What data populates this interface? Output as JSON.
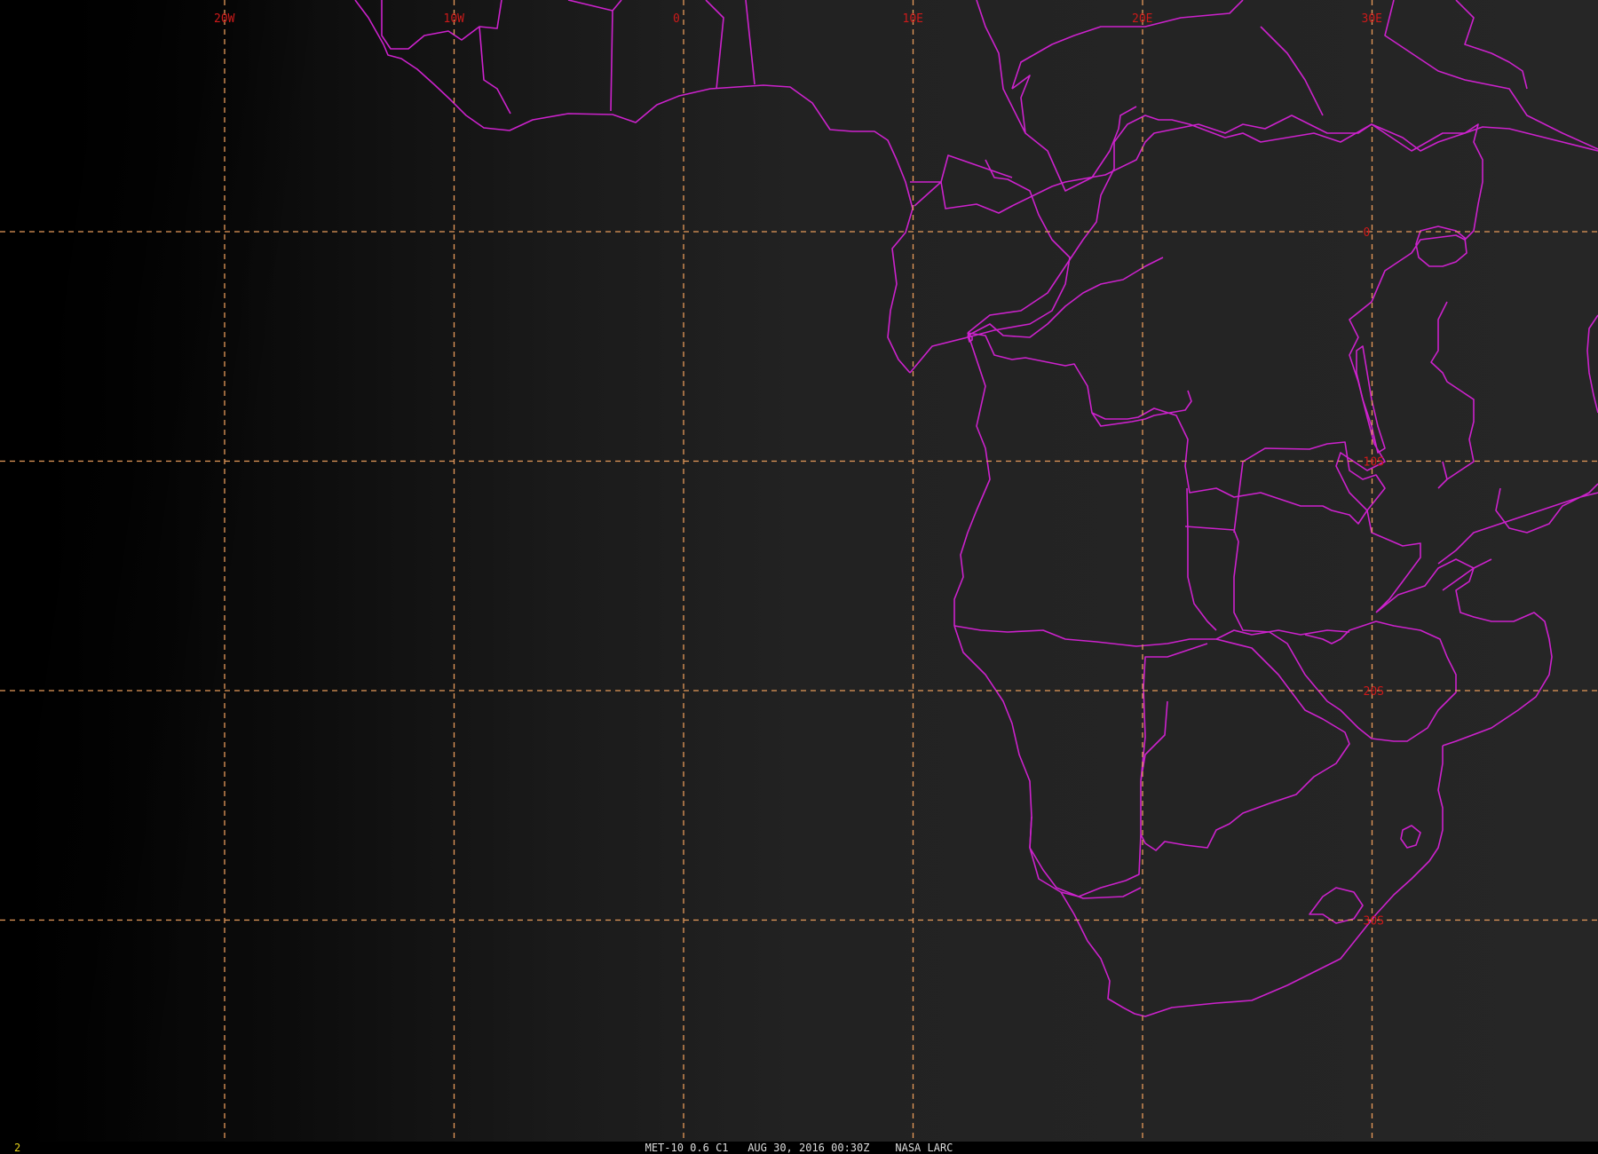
{
  "image": {
    "caption": "MET-10 0.6 C1   AUG 30, 2016 00:30Z    NASA LARC",
    "frame_number": "2"
  },
  "grid": {
    "longitudes": [
      {
        "value": -20,
        "label": "20W"
      },
      {
        "value": -10,
        "label": "10W"
      },
      {
        "value": 0,
        "label": "0"
      },
      {
        "value": 10,
        "label": "10E"
      },
      {
        "value": 20,
        "label": "20E"
      },
      {
        "value": 30,
        "label": "30E"
      }
    ],
    "latitudes": [
      {
        "value": 0,
        "label": "0"
      },
      {
        "value": -10,
        "label": "10S"
      },
      {
        "value": -20,
        "label": "20S"
      },
      {
        "value": -30,
        "label": "30S"
      }
    ]
  },
  "colors": {
    "grid": "#e69a5a",
    "borders": "#cc22cc",
    "grid_labels": "#cc1a1a",
    "frame_number": "#e6d21a",
    "caption": "#dddddd"
  }
}
